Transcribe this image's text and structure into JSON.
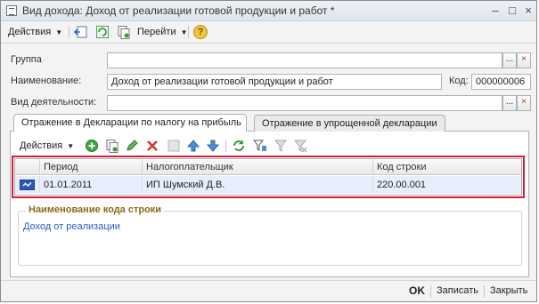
{
  "window": {
    "title": "Вид дохода: Доход от реализации готовой продукции и работ *",
    "min_glyph": "–",
    "max_glyph": "□",
    "close_glyph": "×"
  },
  "toolbar": {
    "actions_label": "Действия",
    "goto_label": "Перейти",
    "help_glyph": "?"
  },
  "form": {
    "group_label": "Группа",
    "group_value": "",
    "name_label": "Наименование:",
    "name_value": "Доход от реализации готовой продукции и работ",
    "code_label": "Код:",
    "code_value": "000000006",
    "activity_label": "Вид деятельности:",
    "activity_value": "",
    "select_glyph": "...",
    "clear_glyph": "×"
  },
  "tabs": [
    {
      "label": "Отражение в Декларации по налогу на прибыль",
      "active": true
    },
    {
      "label": "Отражение в упрощенной декларации",
      "active": false
    }
  ],
  "grid_toolbar": {
    "actions_label": "Действия"
  },
  "table": {
    "headers": [
      "Период",
      "Налогоплательщик",
      "Код строки"
    ],
    "rows": [
      {
        "period": "01.01.2011",
        "taxpayer": "ИП Шумский Д.В.",
        "line_code": "220.00.001"
      }
    ]
  },
  "line_name": {
    "title": "Наименование кода строки",
    "value": "Доход от реализации"
  },
  "buttons": {
    "ok": "OK",
    "save": "Записать",
    "close": "Закрыть"
  },
  "colors": {
    "highlight": "#d61f3a",
    "group_title": "#8a6a1b",
    "link": "#2a5bc2"
  }
}
